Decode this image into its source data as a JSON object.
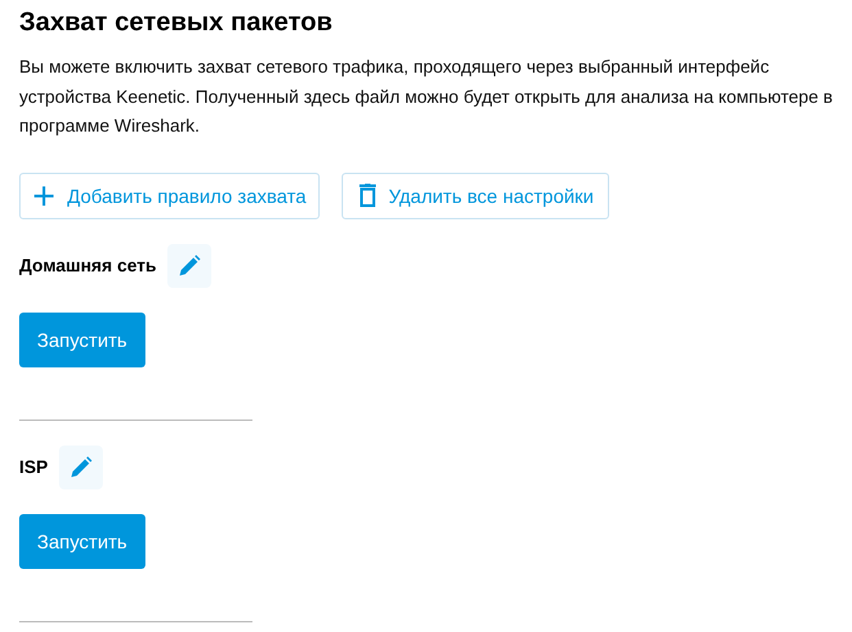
{
  "title": "Захват сетевых пакетов",
  "description": "Вы можете включить захват сетевого трафика, проходящего через выбранный интерфейс устройства Keenetic. Полученный здесь файл можно будет открыть для анализа на компьютере в программе Wireshark.",
  "actions": [
    {
      "kind": "add",
      "label": "Добавить правило захвата"
    },
    {
      "kind": "delete",
      "label": "Удалить все настройки"
    }
  ],
  "rules": [
    {
      "name": "Домашняя сеть",
      "button": "Запустить"
    },
    {
      "name": "ISP",
      "button": "Запустить"
    }
  ]
}
